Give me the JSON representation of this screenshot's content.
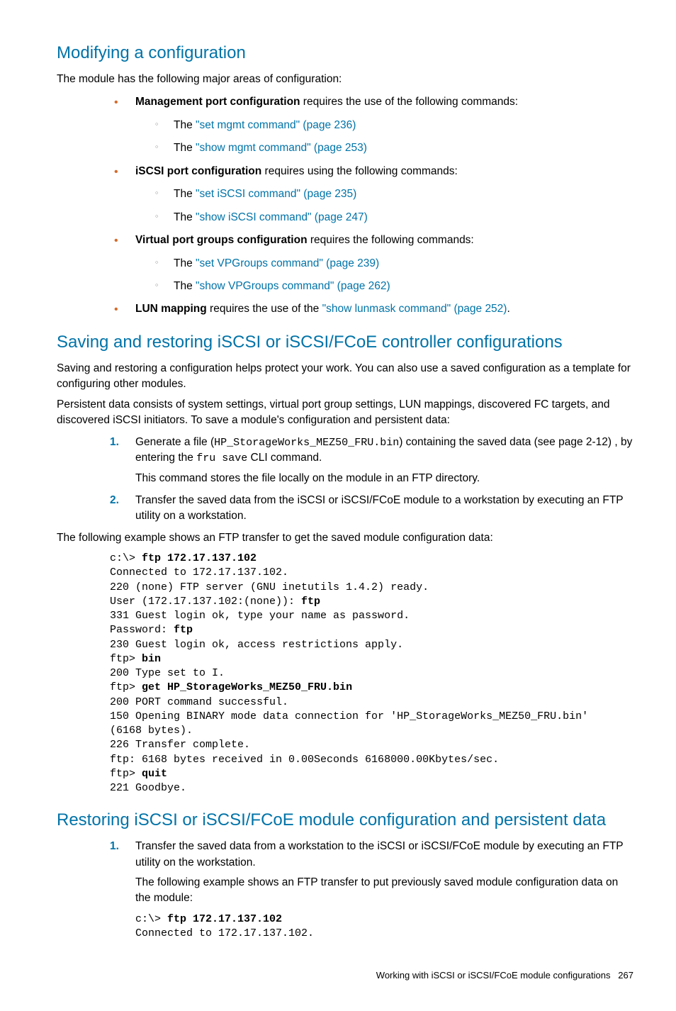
{
  "sec1": {
    "title": "Modifying a configuration",
    "intro": "The module has the following major areas of configuration:",
    "b1": {
      "label": "Management port configuration",
      "tail": " requires the use of the following commands:",
      "s1p": "The ",
      "s1l": "\"set mgmt command\" (page 236)",
      "s2p": "The ",
      "s2l": "\"show mgmt command\" (page 253)"
    },
    "b2": {
      "label": "iSCSI port configuration",
      "tail": " requires using the following commands:",
      "s1p": "The ",
      "s1l": "\"set iSCSI command\" (page 235)",
      "s2p": "The ",
      "s2l": "\"show iSCSI command\" (page 247)"
    },
    "b3": {
      "label": "Virtual port groups configuration",
      "tail": " requires the following commands:",
      "s1p": "The ",
      "s1l": "\"set VPGroups command\" (page 239)",
      "s2p": "The ",
      "s2l": "\"show VPGroups command\" (page 262)"
    },
    "b4": {
      "label": "LUN mapping",
      "tail1": " requires the use of the ",
      "link": "\"show lunmask command\" (page 252)",
      "tail2": "."
    }
  },
  "sec2": {
    "title": "Saving and restoring iSCSI or iSCSI/FCoE controller configurations",
    "p1": "Saving and restoring a configuration helps protect your work. You can also use a saved configuration as a template for configuring other modules.",
    "p2": "Persistent data consists of system settings, virtual port group settings, LUN mappings, discovered FC targets, and discovered iSCSI initiators. To save a module's configuration and persistent data:",
    "step1a": "Generate a file (",
    "step1file": "HP_StorageWorks_MEZ50_FRU.bin",
    "step1b": ") containing the saved data (see page 2-12) , by entering the ",
    "step1cmd": "fru save",
    "step1c": " CLI command.",
    "step1note": "This command stores the file locally on the module in an FTP directory.",
    "step2": "Transfer the saved data from the iSCSI or iSCSI/FCoE module to a workstation by executing an FTP utility on a workstation.",
    "p3": "The following example shows an FTP transfer to get the saved module configuration data:",
    "code": {
      "l01a": "c:\\> ",
      "l01b": "ftp 172.17.137.102",
      "l02": "Connected to 172.17.137.102.",
      "l03": "220 (none) FTP server (GNU inetutils 1.4.2) ready.",
      "l04a": "User (172.17.137.102:(none)): ",
      "l04b": "ftp",
      "l05": "331 Guest login ok, type your name as password.",
      "l06a": "Password: ",
      "l06b": "ftp",
      "l07": "230 Guest login ok, access restrictions apply.",
      "l08a": "ftp> ",
      "l08b": "bin",
      "l09": "200 Type set to I.",
      "l10a": "ftp> ",
      "l10b": "get HP_StorageWorks_MEZ50_FRU.bin",
      "l11": "200 PORT command successful.",
      "l12": "150 Opening BINARY mode data connection for 'HP_StorageWorks_MEZ50_FRU.bin'",
      "l13": "(6168 bytes).",
      "l14": "226 Transfer complete.",
      "l15": "ftp: 6168 bytes received in 0.00Seconds 6168000.00Kbytes/sec.",
      "l16a": "ftp> ",
      "l16b": "quit",
      "l17": "221 Goodbye."
    }
  },
  "sec3": {
    "title": "Restoring iSCSI or iSCSI/FCoE module configuration and persistent data",
    "step1": "Transfer the saved data from a workstation to the iSCSI or iSCSI/FCoE module by executing an FTP utility on the workstation.",
    "p1": "The following example shows an FTP transfer to put previously saved module configuration data on the module:",
    "code": {
      "l01a": "c:\\> ",
      "l01b": "ftp 172.17.137.102",
      "l02": "Connected to 172.17.137.102."
    }
  },
  "footer": {
    "text": "Working with iSCSI or iSCSI/FCoE module configurations",
    "page": "267"
  }
}
